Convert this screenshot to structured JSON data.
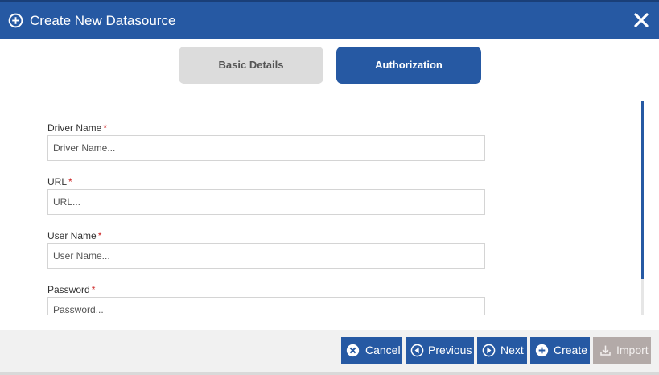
{
  "dialog": {
    "title": "Create New Datasource",
    "icons": {
      "title": "plus-circle-icon",
      "close": "close-icon"
    }
  },
  "tabs": [
    {
      "label": "Basic Details",
      "active": false
    },
    {
      "label": "Authorization",
      "active": true
    }
  ],
  "form": {
    "fields": [
      {
        "label": "Driver Name",
        "required": "*",
        "placeholder": "Driver Name...",
        "value": ""
      },
      {
        "label": "URL",
        "required": "*",
        "placeholder": "URL...",
        "value": ""
      },
      {
        "label": "User Name",
        "required": "*",
        "placeholder": "User Name...",
        "value": ""
      },
      {
        "label": "Password",
        "required": "*",
        "placeholder": "Password...",
        "value": ""
      }
    ]
  },
  "footer": {
    "buttons": {
      "cancel": {
        "label": "Cancel",
        "icon": "x-circle-icon"
      },
      "previous": {
        "label": "Previous",
        "icon": "arrow-left-circle-icon"
      },
      "next": {
        "label": "Next",
        "icon": "arrow-right-circle-icon"
      },
      "create": {
        "label": "Create",
        "icon": "plus-circle-icon"
      },
      "import": {
        "label": "Import",
        "icon": "download-icon",
        "disabled": true
      }
    }
  },
  "colors": {
    "primary": "#2659a3",
    "tab_inactive": "#dcdcdc",
    "required": "#cc2222",
    "footer_bg": "#f1f1f1",
    "disabled": "#b3aaa8"
  }
}
